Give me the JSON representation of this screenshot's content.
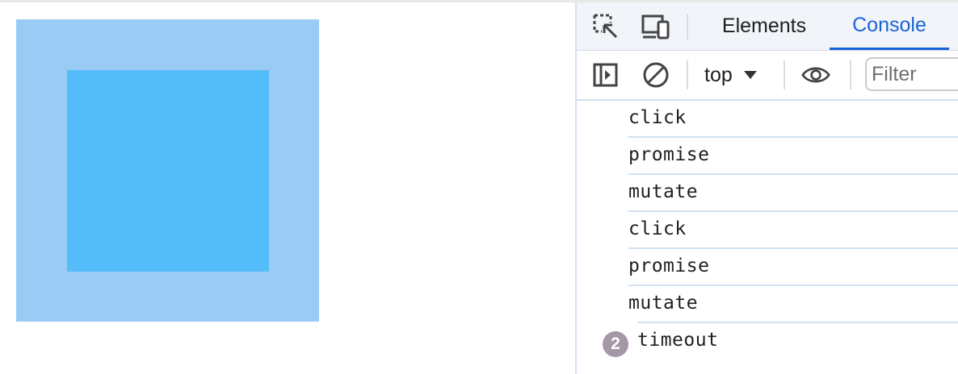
{
  "devtools": {
    "tabs": [
      {
        "label": "Elements",
        "active": false
      },
      {
        "label": "Console",
        "active": true
      }
    ],
    "toolbar": {
      "context": "top",
      "filter_placeholder": "Filter"
    },
    "icons": [
      "inspect-element-icon",
      "device-toolbar-icon",
      "sidebar-toggle-icon",
      "clear-console-icon",
      "dropdown-arrow-icon",
      "live-expression-eye-icon"
    ],
    "accent_color": "#1a63d6"
  },
  "console": {
    "messages": [
      {
        "text": "click"
      },
      {
        "text": "promise"
      },
      {
        "text": "mutate"
      },
      {
        "text": "click"
      },
      {
        "text": "promise"
      },
      {
        "text": "mutate"
      },
      {
        "text": "timeout",
        "count": "2"
      }
    ]
  },
  "page": {
    "outer_color": "#99cbf5",
    "inner_color": "#55bcfa"
  }
}
